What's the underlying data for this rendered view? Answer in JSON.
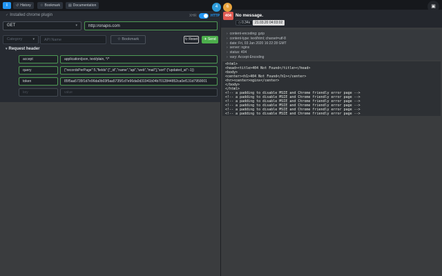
{
  "icons": {
    "check": "✓",
    "caret_down": "▾",
    "star": "☆",
    "history": "↺",
    "doc": "▤",
    "send": "✈",
    "reset": "↻",
    "bullet": "›",
    "clock": "◷",
    "box": "▣"
  },
  "topbar": {
    "info_label": "i",
    "history_label": "History",
    "bookmark_label": "Bookmark",
    "documentation_label": "Documentation",
    "blue_badge": "4",
    "orange_badge": "6"
  },
  "left": {
    "plugin_label": "Installed chrome plugin",
    "mode_left": "XHR",
    "mode_right": "HTTP",
    "method_value": "GET",
    "url_value": "http://onapis.com",
    "category_placeholder": "Category",
    "api_name_placeholder": "API Name",
    "bookmark_label": "Bookmark",
    "reset_label": "Reset",
    "send_label": "Send",
    "section_label": "Request header",
    "header_rows": [
      {
        "key": "accept",
        "value": "application/json, text/plain, */*"
      },
      {
        "key": "query",
        "value": "{\"recordsPerPage\":5,\"fields\":[\"_id\",\"name\",\"api\",\"web\",\"mail\"],\"sort\":{\"updated_at\":-1}}"
      },
      {
        "key": "token",
        "value": "85f5aa5735f1d7e96da0b03f5aa5735f1d7e96da0d31941b04b7012844852ca0ef131d7950001"
      }
    ],
    "empty_row": {
      "key_placeholder": "key",
      "value_placeholder": "value"
    }
  },
  "right": {
    "status_code": "404",
    "status_message": "No message.",
    "time_label": "0.34s",
    "timestamp": "21.03.20 04:03:02",
    "response_headers": [
      "content-encoding: gzip",
      "content-type: text/html; charset=utf-8",
      "date: Fri, 03 Jan 2020 16:22:28 GMT",
      "server: nginx",
      "status: 404",
      "vary: Accept-Encoding"
    ],
    "body_lines": [
      "<html>",
      "<head><title>404 Not Found</title></head>",
      "<body>",
      "<center><h1>404 Not Found</h1></center>",
      "<hr><center>nginx</center>",
      "</body>",
      "</html>",
      "<!-- a padding to disable MSIE and Chrome friendly error page -->",
      "<!-- a padding to disable MSIE and Chrome friendly error page -->",
      "<!-- a padding to disable MSIE and Chrome friendly error page -->",
      "<!-- a padding to disable MSIE and Chrome friendly error page -->",
      "<!-- a padding to disable MSIE and Chrome friendly error page -->",
      "<!-- a padding to disable MSIE and Chrome friendly error page -->"
    ]
  },
  "colors": {
    "accent_blue": "#2196f3",
    "success_green": "#4cae4c",
    "error_red": "#e05a52",
    "input_border_green": "#4f9b55",
    "topbar_bg": "#16181c",
    "panel_bg": "#262a31",
    "page_bg": "#3a3c3e"
  }
}
